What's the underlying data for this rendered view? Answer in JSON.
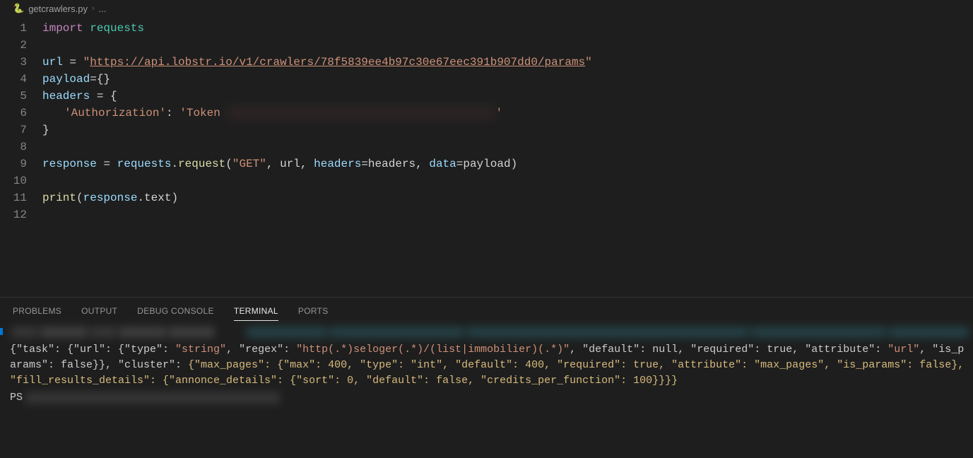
{
  "breadcrumb": {
    "icon": "🐍",
    "filename": "getcrawlers.py",
    "separator": "›",
    "trail": "..."
  },
  "editor": {
    "line_count": 12,
    "code": {
      "l1_kw": "import",
      "l1_mod": " requests",
      "l3_var": "url",
      "l3_op": " = ",
      "l3_q": "\"",
      "l3_url": "https://api.lobstr.io/v1/crawlers/78f5839ee4b97c30e67eec391b907dd0/params",
      "l4_var": "payload",
      "l4_rest": "={}",
      "l5_var": "headers",
      "l5_rest": " = {",
      "l6_key": "'Authorization'",
      "l6_sep": ": ",
      "l6_valpre": "'Token ",
      "l6_valpost": "'",
      "l7": "}",
      "l9_var": "response",
      "l9_eq": " = ",
      "l9_mod": "requests",
      "l9_dot": ".",
      "l9_fn": "request",
      "l9_open": "(",
      "l9_str": "\"GET\"",
      "l9_args_a": ", url, ",
      "l9_kw1": "headers",
      "l9_args_b": "=headers, ",
      "l9_kw2": "data",
      "l9_args_c": "=payload)",
      "l11_fn": "print",
      "l11_open": "(",
      "l11_var": "response",
      "l11_rest": ".text)"
    }
  },
  "panel": {
    "tabs": [
      "PROBLEMS",
      "OUTPUT",
      "DEBUG CONSOLE",
      "TERMINAL",
      "PORTS"
    ],
    "active_tab_index": 3
  },
  "terminal": {
    "json_output": {
      "pre": "{\"task\": {\"url\": {\"type\": ",
      "s1": "\"string\"",
      "m1": ", \"regex\": ",
      "s2": "\"http(.*)seloger(.*)/(list|immobilier)(.*)\"",
      "m2": ", \"default\": null, \"required\": true, \"attribute\": ",
      "s3": "\"url\"",
      "m3": ", \"is_params\": false}}, \"cluster\": ",
      "hl": "{\"max_pages\": {\"max\": 400, \"type\": \"int\", \"default\": 400, \"required\": true, \"attribute\": \"max_pages\", \"is_params\": false}, \"fill_results_details\": {\"annonce_details\": {\"sort\": 0, \"default\": false, \"credits_per_function\": 100}}}}",
      "post": ""
    },
    "prompt": "PS"
  }
}
